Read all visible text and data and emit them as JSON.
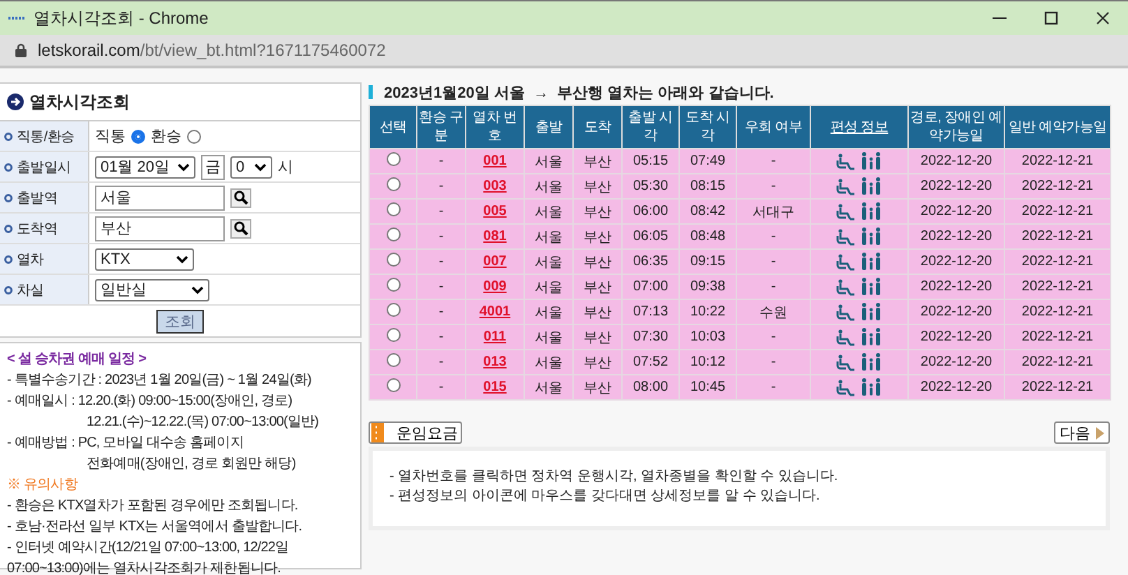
{
  "window": {
    "title": "열차시각조회 - Chrome",
    "url_host": "letskorail.com",
    "url_path": "/bt/view_bt.html?1671175460072"
  },
  "form": {
    "title": "열차시각조회",
    "rows": [
      {
        "kind": "radio",
        "label": "직통/환승",
        "options": [
          {
            "label": "직통",
            "selected": true
          },
          {
            "label": "환승",
            "selected": false
          }
        ]
      },
      {
        "kind": "datetime",
        "label": "출발일시",
        "date": "01월 20일",
        "weekday": "금",
        "hour": "0",
        "unit": "시"
      },
      {
        "kind": "station",
        "label": "출발역",
        "value": "서울"
      },
      {
        "kind": "station",
        "label": "도착역",
        "value": "부산"
      },
      {
        "kind": "select",
        "label": "열차",
        "value": "KTX"
      },
      {
        "kind": "select",
        "label": "차실",
        "value": "일반실"
      }
    ],
    "submit": "조회"
  },
  "notice": {
    "lines": [
      {
        "kind": "title",
        "text": "< 설 승차권 예매 일정 >"
      },
      {
        "kind": "item",
        "text": "- 특별수송기간 : 2023년 1월 20일(금) ~ 1월 24일(화)"
      },
      {
        "kind": "item",
        "text": "- 예매일시 : 12.20.(화) 09:00~15:00(장애인, 경로)"
      },
      {
        "kind": "indent",
        "text": "12.21.(수)~12.22.(목) 07:00~13:00(일반)"
      },
      {
        "kind": "item",
        "text": "- 예매방법 : PC, 모바일 대수송 홈페이지"
      },
      {
        "kind": "indent",
        "text": "전화예매(장애인, 경로 회원만 해당)"
      },
      {
        "kind": "warning",
        "text": "※ 유의사항"
      },
      {
        "kind": "item",
        "text": "- 환승은 KTX열차가 포함된 경우에만 조회됩니다."
      },
      {
        "kind": "item",
        "text": "- 호남·전라선 일부 KTX는 서울역에서 출발합니다."
      },
      {
        "kind": "item",
        "text": "- 인터넷 예약시간(12/21일 07:00~13:00, 12/22일 07:00~13:00)에는 열차시각조회가 제한됩니다."
      }
    ]
  },
  "results": {
    "heading": "2023년1월20일 서울  →  부산행 열차는 아래와 같습니다.",
    "columns": [
      {
        "label": "선택",
        "link": false
      },
      {
        "label": "환승 구분",
        "link": false
      },
      {
        "label": "열차 번호",
        "link": false
      },
      {
        "label": "출발",
        "link": false
      },
      {
        "label": "도착",
        "link": false
      },
      {
        "label": "출발 시각",
        "link": false
      },
      {
        "label": "도착 시각",
        "link": false
      },
      {
        "label": "우회 여부",
        "link": false
      },
      {
        "label": "편성 정보",
        "link": true
      },
      {
        "label": "경로, 장애인 예약가능일",
        "link": false
      },
      {
        "label": "일반 예약가능일",
        "link": false
      }
    ],
    "rows": [
      {
        "selected": false,
        "transfer": "-",
        "train": "001",
        "from": "서울",
        "to": "부산",
        "dep": "05:15",
        "arr": "07:49",
        "detour": "-",
        "senior_date": "2022-12-20",
        "general_date": "2022-12-21"
      },
      {
        "selected": false,
        "transfer": "-",
        "train": "003",
        "from": "서울",
        "to": "부산",
        "dep": "05:30",
        "arr": "08:15",
        "detour": "-",
        "senior_date": "2022-12-20",
        "general_date": "2022-12-21"
      },
      {
        "selected": false,
        "transfer": "-",
        "train": "005",
        "from": "서울",
        "to": "부산",
        "dep": "06:00",
        "arr": "08:42",
        "detour": "서대구",
        "senior_date": "2022-12-20",
        "general_date": "2022-12-21"
      },
      {
        "selected": false,
        "transfer": "-",
        "train": "081",
        "from": "서울",
        "to": "부산",
        "dep": "06:05",
        "arr": "08:48",
        "detour": "-",
        "senior_date": "2022-12-20",
        "general_date": "2022-12-21"
      },
      {
        "selected": false,
        "transfer": "-",
        "train": "007",
        "from": "서울",
        "to": "부산",
        "dep": "06:35",
        "arr": "09:15",
        "detour": "-",
        "senior_date": "2022-12-20",
        "general_date": "2022-12-21"
      },
      {
        "selected": false,
        "transfer": "-",
        "train": "009",
        "from": "서울",
        "to": "부산",
        "dep": "07:00",
        "arr": "09:38",
        "detour": "-",
        "senior_date": "2022-12-20",
        "general_date": "2022-12-21"
      },
      {
        "selected": false,
        "transfer": "-",
        "train": "4001",
        "from": "서울",
        "to": "부산",
        "dep": "07:13",
        "arr": "10:22",
        "detour": "수원",
        "senior_date": "2022-12-20",
        "general_date": "2022-12-21"
      },
      {
        "selected": false,
        "transfer": "-",
        "train": "011",
        "from": "서울",
        "to": "부산",
        "dep": "07:30",
        "arr": "10:03",
        "detour": "-",
        "senior_date": "2022-12-20",
        "general_date": "2022-12-21"
      },
      {
        "selected": false,
        "transfer": "-",
        "train": "013",
        "from": "서울",
        "to": "부산",
        "dep": "07:52",
        "arr": "10:12",
        "detour": "-",
        "senior_date": "2022-12-20",
        "general_date": "2022-12-21"
      },
      {
        "selected": false,
        "transfer": "-",
        "train": "015",
        "from": "서울",
        "to": "부산",
        "dep": "08:00",
        "arr": "10:45",
        "detour": "-",
        "senior_date": "2022-12-20",
        "general_date": "2022-12-21"
      }
    ],
    "fare_button": "운임요금",
    "next_button": "다음",
    "info": [
      "- 열차번호를 클릭하면 정차역 운행시각, 열차종별을 확인할 수 있습니다.",
      "- 편성정보의 아이콘에 마우스를 갖다대면 상세정보를 알 수 있습니다."
    ]
  }
}
